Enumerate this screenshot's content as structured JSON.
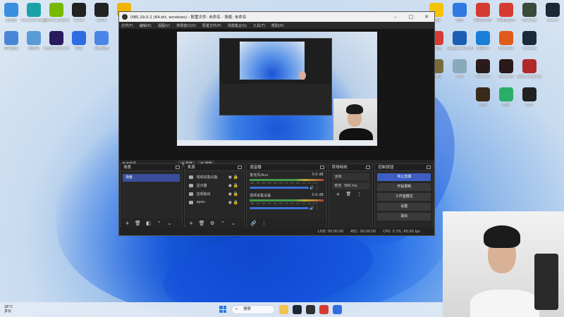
{
  "desktop": {
    "left_icons": [
      {
        "label": "此电脑",
        "color": "#3a8fe0"
      },
      {
        "label": "Microsoft Edge",
        "color": "#1aa2a8"
      },
      {
        "label": "GeForce Experience",
        "color": "#76b900"
      },
      {
        "label": "Gopix",
        "color": "#222222"
      },
      {
        "label": "KOOK",
        "color": "#222222"
      },
      {
        "label": "看图",
        "color": "#f2b400"
      },
      {
        "label": "控制面板",
        "color": "#4a86d8"
      },
      {
        "label": "回收站",
        "color": "#5b9bd5"
      },
      {
        "label": "Adobe Premiere",
        "color": "#2a1a5e"
      },
      {
        "label": "网易",
        "color": "#2f6de1"
      },
      {
        "label": "百度网盘",
        "color": "#4a86e8"
      }
    ],
    "right_icons": [
      {
        "label": "地图",
        "color": "#f5c400"
      },
      {
        "label": "应用",
        "color": "#2f7ae0"
      },
      {
        "label": "网易云音乐",
        "color": "#d43c33"
      },
      {
        "label": "网易云音乐",
        "color": "#d43c33"
      },
      {
        "label": "Wireless",
        "color": "#3a4a3a"
      },
      {
        "label": "Steam",
        "color": "#1b2838"
      },
      {
        "label": "网易云",
        "color": "#d43c33"
      },
      {
        "label": "Wallpaper Engine",
        "color": "#1d5cb3"
      },
      {
        "label": "网易UU",
        "color": "#1a7fd6"
      },
      {
        "label": "ArenaVR",
        "color": "#e05a1a"
      },
      {
        "label": "Aimlabs",
        "color": "#1a2a3a"
      },
      {
        "label": "PUBG",
        "color": "#7a6a3a"
      },
      {
        "label": "游戏",
        "color": "#8ab"
      },
      {
        "label": "Valorant",
        "color": "#2a1a1a"
      },
      {
        "label": "Valorant",
        "color": "#2a1a1a"
      },
      {
        "label": "Apex Legends",
        "color": "#b02a2a"
      },
      {
        "label": "游戏",
        "color": "#3a2a1a"
      },
      {
        "label": "微信",
        "color": "#2aae67"
      },
      {
        "label": "OBS",
        "color": "#222222"
      }
    ]
  },
  "obs": {
    "title": "OBS 29.0.2 (64-bit, windows) - 配置文件: 未命名 - 场景: 未命名",
    "menu": [
      "文件(F)",
      "编辑(E)",
      "视图(V)",
      "停靠窗口(D)",
      "配置文件(P)",
      "场景集合(S)",
      "工具(T)",
      "帮助(H)"
    ],
    "no_source": "未选择源",
    "prop_btn": "属性",
    "filter_btn": "滤镜",
    "docks": {
      "scenes": {
        "title": "场景",
        "items": [
          "场景"
        ]
      },
      "sources": {
        "title": "来源",
        "items": [
          "视频采集设备",
          "显示器",
          "音频输出",
          "apex"
        ]
      },
      "mixer": {
        "title": "混音器",
        "channels": [
          {
            "name": "麦克风/Aux",
            "db": "0.0 dB"
          },
          {
            "name": "视频采集设备",
            "db": "0.0 dB"
          }
        ],
        "scale": "-60 -55 -50 -45 -40 -35 -30 -25 -20 -15 -10 -5 0"
      },
      "transitions": {
        "title": "转场特效",
        "type": "淡出",
        "duration_label": "时长",
        "duration": "300 ms"
      },
      "controls": {
        "title": "控制按钮",
        "buttons": [
          "停止直播",
          "开始录制",
          "工作室模式",
          "设置",
          "退出"
        ]
      }
    },
    "status": {
      "live": "LIVE: 00:00:00",
      "rec": "REC: 00:00:00",
      "cpu": "CPU: 0.3%, 60.00 fps"
    }
  },
  "taskbar": {
    "weather_temp": "26°C",
    "weather_desc": "多云",
    "search_label": "搜索",
    "apps": [
      {
        "name": "file-explorer-icon",
        "color": "#f2c14e"
      },
      {
        "name": "steam-icon",
        "color": "#1b2838"
      },
      {
        "name": "obs-icon",
        "color": "#303030"
      },
      {
        "name": "netease-icon",
        "color": "#d43c33"
      },
      {
        "name": "app-icon",
        "color": "#2f6de1"
      }
    ]
  }
}
